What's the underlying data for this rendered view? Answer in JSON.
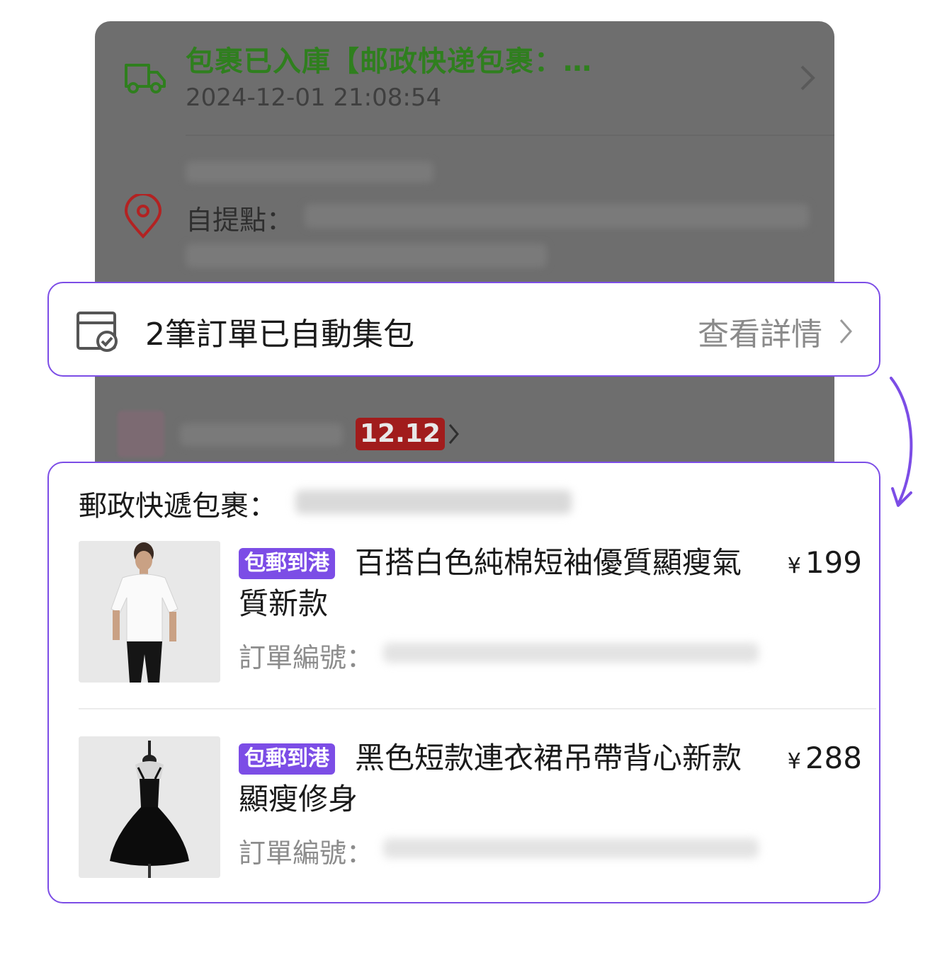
{
  "background_card": {
    "logistics_status": "包裹已入庫【邮政快递包裹：…",
    "logistics_time": "2024-12-01 21:08:54",
    "pickup_label": "自提點：",
    "promo_badge": "12.12"
  },
  "bundle_bar": {
    "message": "2筆訂單已自動集包",
    "link_label": "查看詳情"
  },
  "package": {
    "title": "郵政快遞包裹：",
    "items": [
      {
        "tag": "包郵到港",
        "name": "百搭白色純棉短袖優質顯瘦氣質新款",
        "currency": "¥",
        "price": "199",
        "order_label": "訂單編號："
      },
      {
        "tag": "包郵到港",
        "name": "黑色短款連衣裙吊帶背心新款顯瘦修身",
        "currency": "¥",
        "price": "288",
        "order_label": "訂單編號："
      }
    ]
  },
  "colors": {
    "accent": "#7c4de6",
    "logistics_green": "#2f7f1e",
    "promo_red": "#a11c1c",
    "overlay_gray": "#6e6e6e"
  },
  "icons": {
    "logistics": "truck-icon",
    "pickup": "location-pin-icon",
    "bundle": "package-check-icon",
    "chevron": "chevron-right-icon",
    "flow": "curved-arrow-down-icon"
  }
}
